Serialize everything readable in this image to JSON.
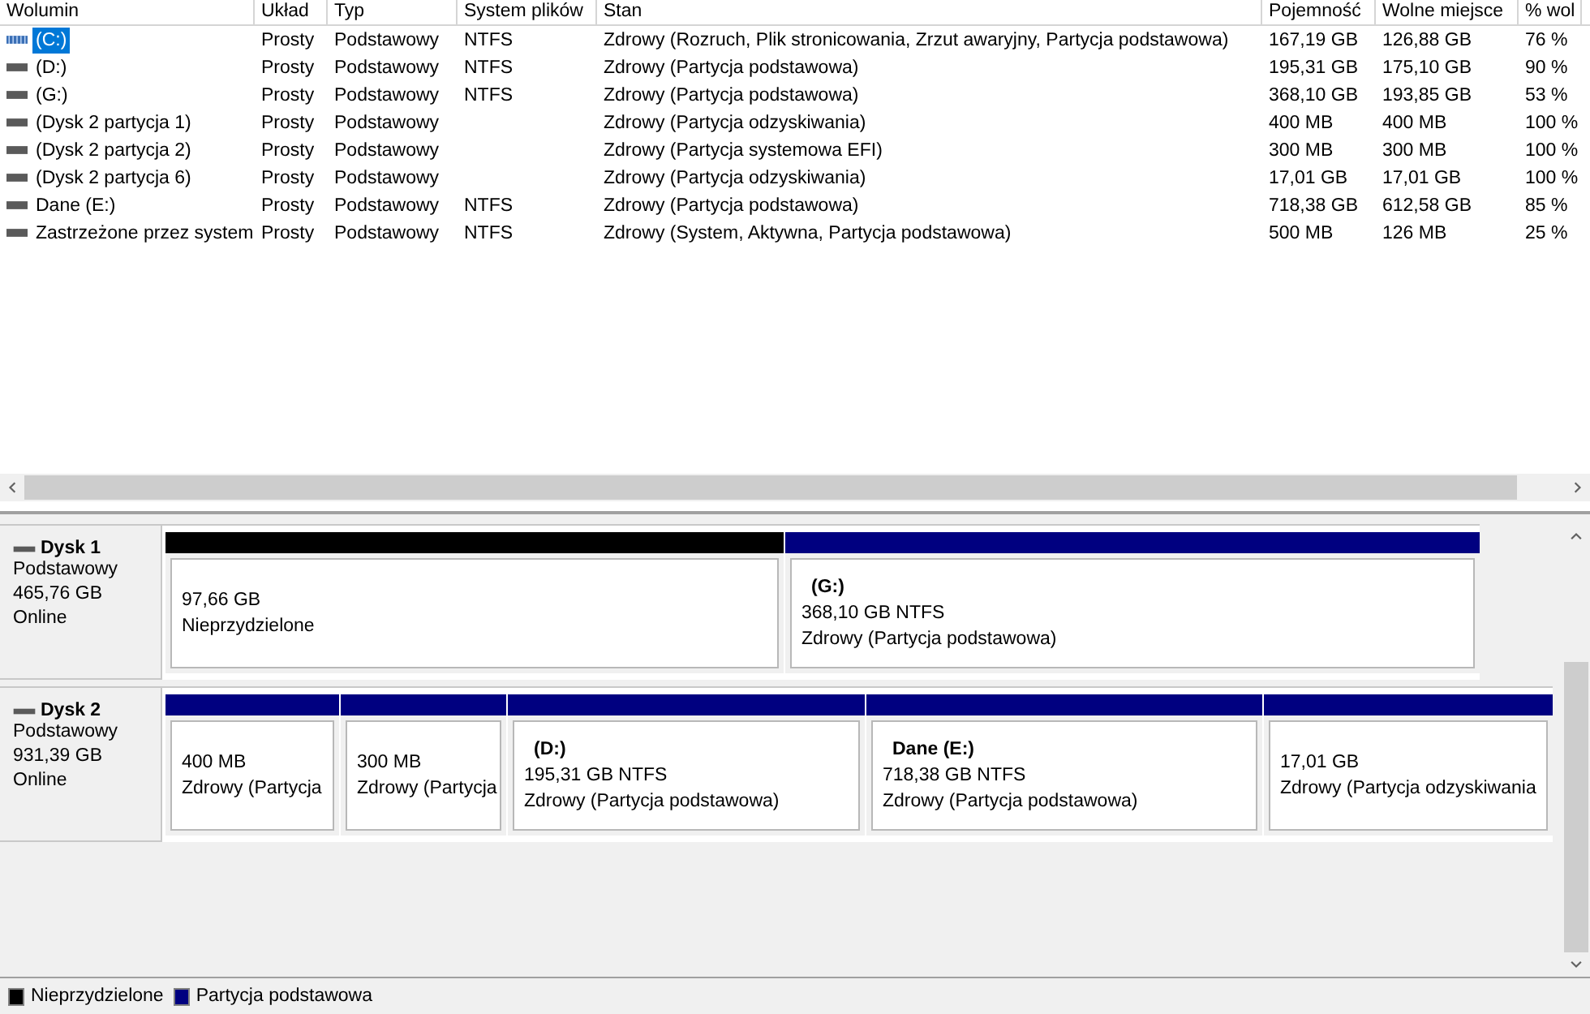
{
  "table": {
    "columns": [
      "Wolumin",
      "Układ",
      "Typ",
      "System plików",
      "Stan",
      "Pojemność",
      "Wolne miejsce",
      "% wol"
    ],
    "rows": [
      {
        "volume": "(C:)",
        "layout": "Prosty",
        "type": "Podstawowy",
        "filesystem": "NTFS",
        "status": "Zdrowy (Rozruch, Plik stronicowania, Zrzut awaryjny, Partycja podstawowa)",
        "capacity": "167,19 GB",
        "free": "126,88 GB",
        "pct_free": "76 %",
        "selected": true
      },
      {
        "volume": "(D:)",
        "layout": "Prosty",
        "type": "Podstawowy",
        "filesystem": "NTFS",
        "status": "Zdrowy (Partycja podstawowa)",
        "capacity": "195,31 GB",
        "free": "175,10 GB",
        "pct_free": "90 %",
        "selected": false
      },
      {
        "volume": "(G:)",
        "layout": "Prosty",
        "type": "Podstawowy",
        "filesystem": "NTFS",
        "status": "Zdrowy (Partycja podstawowa)",
        "capacity": "368,10 GB",
        "free": "193,85 GB",
        "pct_free": "53 %",
        "selected": false
      },
      {
        "volume": "(Dysk 2 partycja 1)",
        "layout": "Prosty",
        "type": "Podstawowy",
        "status": "Zdrowy (Partycja odzyskiwania)",
        "capacity": "400 MB",
        "free": "400 MB",
        "pct_free": "100 %",
        "selected": false
      },
      {
        "volume": "(Dysk 2 partycja 2)",
        "layout": "Prosty",
        "type": "Podstawowy",
        "status": "Zdrowy (Partycja systemowa EFI)",
        "capacity": "300 MB",
        "free": "300 MB",
        "pct_free": "100 %",
        "selected": false
      },
      {
        "volume": "(Dysk 2 partycja 6)",
        "layout": "Prosty",
        "type": "Podstawowy",
        "status": "Zdrowy (Partycja odzyskiwania)",
        "capacity": "17,01 GB",
        "free": "17,01 GB",
        "pct_free": "100 %",
        "selected": false
      },
      {
        "volume": "Dane (E:)",
        "layout": "Prosty",
        "type": "Podstawowy",
        "filesystem": "NTFS",
        "status": "Zdrowy (Partycja podstawowa)",
        "capacity": "718,38 GB",
        "free": "612,58 GB",
        "pct_free": "85 %",
        "selected": false
      },
      {
        "volume": "Zastrzeżone przez system",
        "layout": "Prosty",
        "type": "Podstawowy",
        "filesystem": "NTFS",
        "status": "Zdrowy (System, Aktywna, Partycja podstawowa)",
        "capacity": "500 MB",
        "free": "126 MB",
        "pct_free": "25 %",
        "selected": false
      }
    ]
  },
  "disks": [
    {
      "name": "Dysk 1",
      "type": "Podstawowy",
      "size": "465,76 GB",
      "state": "Online",
      "partitions": [
        {
          "color": "#000000",
          "size": "97,66 GB",
          "status": "Nieprzydzielone"
        },
        {
          "color": "#000080",
          "name": "(G:)",
          "size": "368,10 GB NTFS",
          "status": "Zdrowy (Partycja podstawowa)"
        }
      ]
    },
    {
      "name": "Dysk 2",
      "type": "Podstawowy",
      "size": "931,39 GB",
      "state": "Online",
      "partitions": [
        {
          "color": "#000080",
          "size": "400 MB",
          "status": "Zdrowy (Partycja"
        },
        {
          "color": "#000080",
          "size": "300 MB",
          "status": "Zdrowy (Partycja"
        },
        {
          "color": "#000080",
          "name": "(D:)",
          "size": "195,31 GB NTFS",
          "status": "Zdrowy (Partycja podstawowa)"
        },
        {
          "color": "#000080",
          "name": "Dane  (E:)",
          "size": "718,38 GB NTFS",
          "status": "Zdrowy (Partycja podstawowa)"
        },
        {
          "color": "#000080",
          "size": "17,01 GB",
          "status": "Zdrowy (Partycja odzyskiwania"
        }
      ]
    }
  ],
  "legend": [
    {
      "label": "Nieprzydzielone",
      "color": "#000000"
    },
    {
      "label": "Partycja podstawowa",
      "color": "#000080"
    }
  ]
}
